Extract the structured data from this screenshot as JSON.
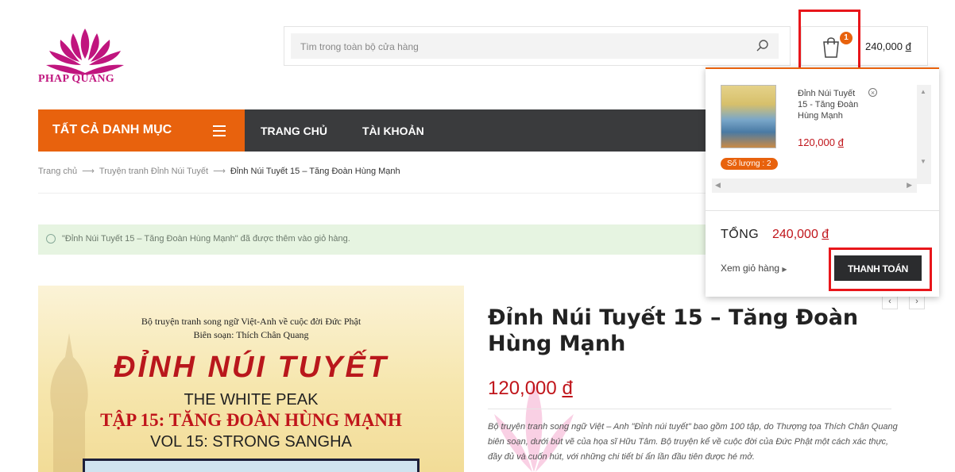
{
  "brand": {
    "name": "PHAP QUANG"
  },
  "search": {
    "placeholder": "Tìm trong toàn bộ cửa hàng"
  },
  "cart": {
    "count": "1",
    "total": "240,000",
    "currency": "đ"
  },
  "nav": {
    "categories_label": "TẤT CẢ DANH MỤC",
    "items": [
      {
        "label": "TRANG CHỦ"
      },
      {
        "label": "TÀI KHOẢN"
      }
    ]
  },
  "breadcrumb": {
    "items": [
      "Trang chủ",
      "Truyện tranh Đỉnh Núi Tuyết",
      "Đỉnh Núi Tuyết 15 – Tăng Đoàn Hùng Mạnh"
    ],
    "separator": "⟶"
  },
  "notice": {
    "text": "\"Đỉnh Núi Tuyết 15 – Tăng Đoàn Hùng Mạnh\" đã được thêm vào giỏ hàng."
  },
  "product_image": {
    "line1": "Bộ truyện tranh song ngữ Việt-Anh về cuộc đời Đức Phật",
    "line2": "Biên soạn: Thích Chân Quang",
    "title": "ĐỈNH NÚI TUYẾT",
    "subtitle_en": "THE WHITE PEAK",
    "vol_vn": "TẬP 15: TĂNG ĐOÀN HÙNG MẠNH",
    "vol_en": "VOL 15: STRONG SANGHA"
  },
  "product": {
    "title": "Đỉnh Núi Tuyết 15 – Tăng Đoàn Hùng Mạnh",
    "price": "120,000",
    "currency": "đ",
    "description": "Bộ truyện tranh song ngữ Việt – Anh \"Đỉnh núi tuyết\" bao gồm 100 tập, do Thượng tọa Thích Chân Quang biên soạn, dưới bút vẽ của họa sĩ Hữu Tâm. Bộ truyện kể về cuộc đời của Đức Phật một cách xác thực, đầy đủ và cuốn hút, với những chi tiết bí ẩn lần đầu tiên được hé mở."
  },
  "mini_cart": {
    "item_name": "Đỉnh Núi Tuyết 15 - Tăng Đoàn Hùng Mạnh",
    "item_price": "120,000",
    "currency": "đ",
    "quantity": "Số lượng : 2",
    "total_label": "TỔNG",
    "total_value": "240,000",
    "view_cart": "Xem giỏ hàng",
    "checkout": "THANH TOÁN"
  },
  "colors": {
    "accent": "#e8620d",
    "price": "#c0151b",
    "nav_bg": "#3a3b3d",
    "highlight": "#e8161b"
  }
}
